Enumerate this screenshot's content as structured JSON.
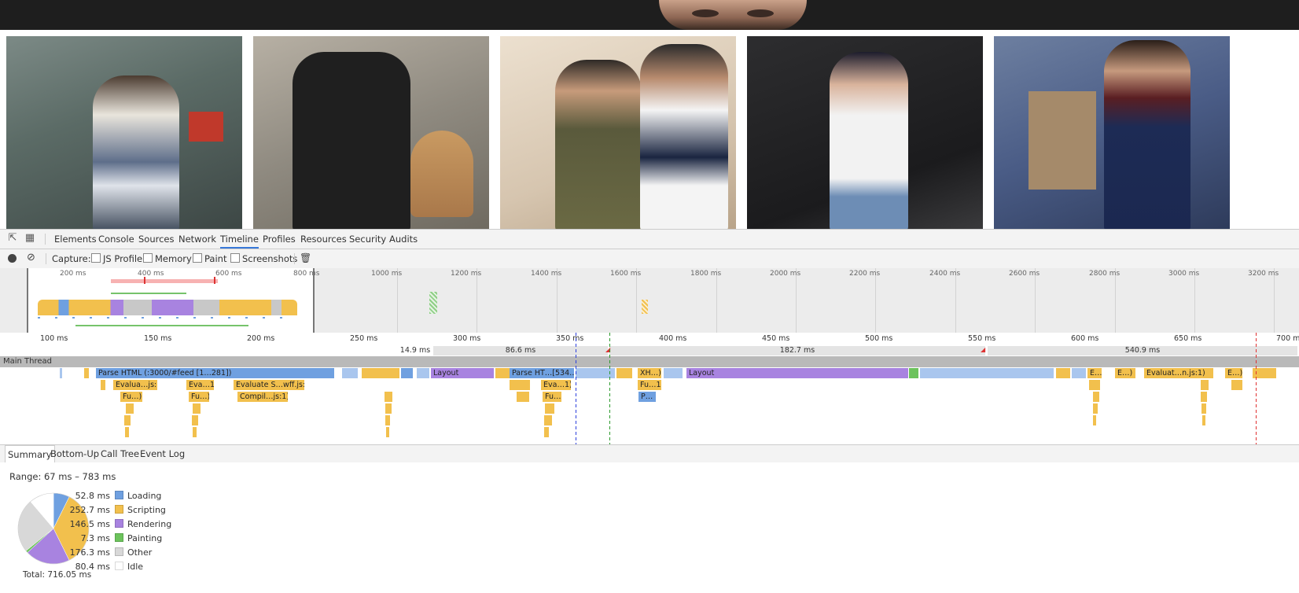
{
  "devtools": {
    "tabs": [
      "Elements",
      "Console",
      "Sources",
      "Network",
      "Timeline",
      "Profiles",
      "Resources",
      "Security",
      "Audits"
    ],
    "active_tab": "Timeline",
    "capture_label": "Capture:",
    "capture_options": [
      "JS Profile",
      "Memory",
      "Paint",
      "Screenshots"
    ]
  },
  "overview": {
    "ticks_selected": [
      "200 ms",
      "400 ms",
      "600 ms",
      "800 ms"
    ],
    "ticks": [
      "1000 ms",
      "1200 ms",
      "1400 ms",
      "1600 ms",
      "1800 ms",
      "2000 ms",
      "2200 ms",
      "2400 ms",
      "2600 ms",
      "2800 ms",
      "3000 ms",
      "3200 ms"
    ]
  },
  "ruler": {
    "ticks": [
      "100 ms",
      "150 ms",
      "200 ms",
      "250 ms",
      "300 ms",
      "350 ms",
      "400 ms",
      "450 ms",
      "500 ms",
      "550 ms",
      "600 ms",
      "650 ms",
      "700 m"
    ]
  },
  "frames": [
    "14.9 ms",
    "86.6 ms",
    "182.7 ms",
    "540.9 ms"
  ],
  "main_thread_label": "Main Thread",
  "events": {
    "parse_html_1": "Parse HTML (:3000/#feed [1…281])",
    "layout_1": "Layout",
    "parse_html_2": "Parse HT…[534…])",
    "xhr": "XH…)",
    "layout_2": "Layout",
    "e1": "E…",
    "e2": "E…)",
    "evaluate_late": "Evaluat…n.js:1)",
    "e3": "E…)",
    "eval_1": "Evalua…js:1)",
    "eval_2": "Eva…1)",
    "eval_swff": "Evaluate S…wff.js:1)",
    "eval_3": "Eva…1)",
    "fu_xhr": "Fu…1)",
    "fu_1": "Fu…)",
    "fu_2": "Fu…)",
    "compile": "Compil…js:1)",
    "fu_3": "Fu…)",
    "paint_p": "P…"
  },
  "bottom_tabs": [
    "Summary",
    "Bottom-Up",
    "Call Tree",
    "Event Log"
  ],
  "summary": {
    "range": "Range: 67 ms – 783 ms",
    "total": "Total: 716.05 ms",
    "categories": [
      {
        "value": "52.8 ms",
        "name": "Loading",
        "color": "#6fa0e0",
        "ms": 52.8
      },
      {
        "value": "252.7 ms",
        "name": "Scripting",
        "color": "#f2c04d",
        "ms": 252.7
      },
      {
        "value": "146.5 ms",
        "name": "Rendering",
        "color": "#a883e0",
        "ms": 146.5
      },
      {
        "value": "7.3 ms",
        "name": "Painting",
        "color": "#6cc35c",
        "ms": 7.3
      },
      {
        "value": "176.3 ms",
        "name": "Other",
        "color": "#d8d8d8",
        "ms": 176.3
      },
      {
        "value": "80.4 ms",
        "name": "Idle",
        "color": "#ffffff",
        "ms": 80.4
      }
    ]
  }
}
